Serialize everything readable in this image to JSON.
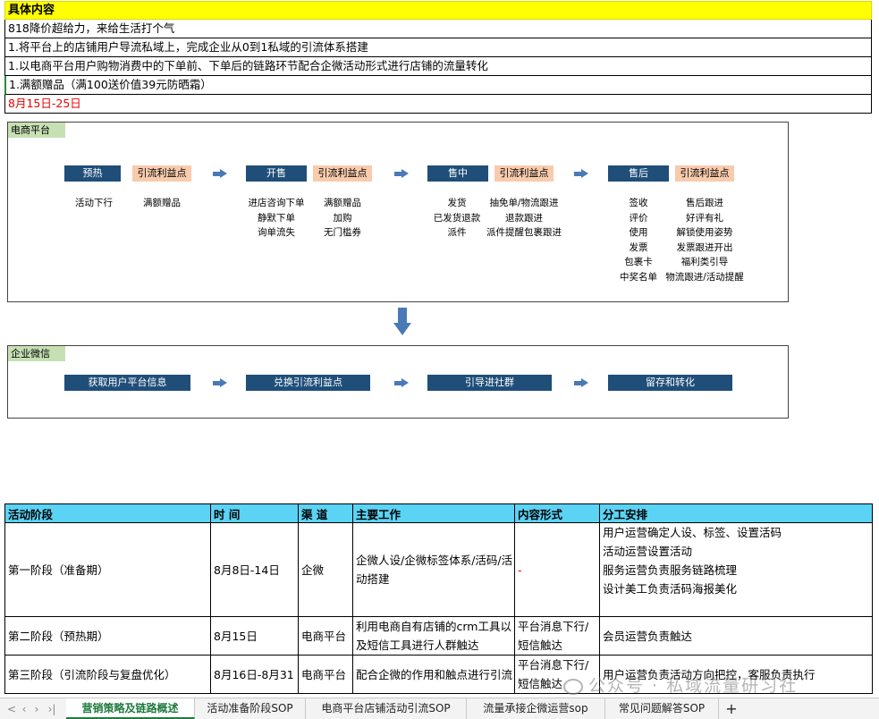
{
  "info": {
    "title": "具体内容",
    "line1": "818降价超给力，来给生活打个气",
    "line2": "1.将平台上的店铺用户导流私域上，完成企业从0到1私域的引流体系搭建",
    "line3": "1.以电商平台用户购物消费中的下单前、下单后的链路环节配合企微活动形式进行店铺的流量转化",
    "line4": "1.满额赠品（满100送价值39元防晒霜）",
    "dates": "8月15日-25日"
  },
  "ecommerce": {
    "label": "电商平台",
    "stages": [
      {
        "name": "预热",
        "benefit": "引流利益点",
        "actions": [
          "活动下行"
        ],
        "benefits": [
          "满额赠品"
        ]
      },
      {
        "name": "开售",
        "benefit": "引流利益点",
        "actions": [
          "进店咨询下单",
          "静默下单",
          "询单流失"
        ],
        "benefits": [
          "满额赠品",
          "加购",
          "无门槛券"
        ]
      },
      {
        "name": "售中",
        "benefit": "引流利益点",
        "actions": [
          "发货",
          "已发货退款",
          "派件"
        ],
        "benefits": [
          "抽免单/物流跟进",
          "退款跟进",
          "派件提醒包裹跟进"
        ]
      },
      {
        "name": "售后",
        "benefit": "引流利益点",
        "actions": [
          "签收",
          "评价",
          "使用",
          "发票",
          "包裹卡",
          "中奖名单"
        ],
        "benefits": [
          "售后跟进",
          "好评有礼",
          "解锁使用姿势",
          "发票跟进开出",
          "福利类引导",
          "物流跟进/活动提醒"
        ]
      }
    ]
  },
  "wecom": {
    "label": "企业微信",
    "steps": [
      "获取用户平台信息",
      "兑换引流利益点",
      "引导进社群",
      "留存和转化"
    ]
  },
  "table": {
    "headers": [
      "活动阶段",
      "时  间",
      "渠  道",
      "主要工作",
      "内容形式",
      "分工安排"
    ],
    "rows": [
      {
        "stage": "第一阶段（准备期）",
        "time": "8月8日-14日",
        "channel": "企微",
        "work": "企微人设/企微标签体系/活码/活动搭建",
        "form": "-",
        "assign": [
          "用户运营确定人设、标签、设置活码",
          "活动运营设置活动",
          "服务运营负责服务链路梳理",
          "设计美工负责活码海报美化"
        ]
      },
      {
        "stage": "第二阶段（预热期）",
        "time": "8月15日",
        "channel": "电商平台",
        "work": "利用电商自有店铺的crm工具以及短信工具进行人群触达",
        "form": "平台消息下行/短信触达",
        "assign": [
          "会员运营负责触达"
        ]
      },
      {
        "stage": "第三阶段（引流阶段与复盘优化）",
        "time": "8月16日-8月31",
        "channel": "电商平台",
        "work": "配合企微的作用和触点进行引流",
        "form": "平台消息下行/短信触达",
        "assign": [
          "用户运营负责活动方向把控，客服负责执行"
        ]
      }
    ]
  },
  "watermark": "公众号 · 私域流量研习社",
  "tabs": {
    "nav": [
      "‹",
      "›",
      "›|"
    ],
    "nav_first": "<",
    "items": [
      "营销策略及链路概述",
      "活动准备阶段SOP",
      "电商平台店铺活动引流SOP",
      "流量承接企微运营sop",
      "常见问题解答SOP"
    ],
    "active": 0,
    "add": "+"
  },
  "colors": {
    "title_bg": "#ffff00",
    "stage_bg": "#1f4e79",
    "benefit_bg": "#f8cbad",
    "panel_label_bg": "#c6e0b4",
    "table_header_bg": "#5bd3f5",
    "arrow": "#4a7ab5",
    "date_red": "#e60000",
    "active_tab": "#1e7a3e"
  }
}
